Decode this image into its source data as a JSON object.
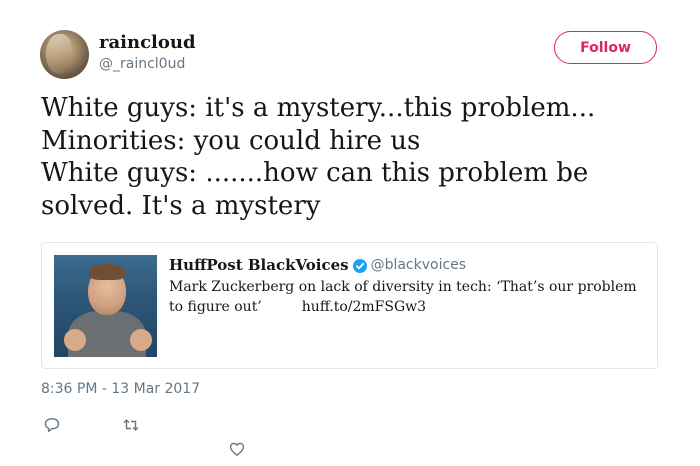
{
  "tweet": {
    "display_name": "raincloud",
    "username": "@_raincl0ud",
    "follow_label": "Follow",
    "text_lines": [
      "White guys: it's a mystery...this problem...",
      "Minorities: you could hire us",
      "White guys: .......how can this problem be",
      "solved. It's a mystery"
    ],
    "timestamp": "8:36 PM - 13 Mar 2017"
  },
  "quote": {
    "name": "HuffPost BlackVoices",
    "handle": "@blackvoices",
    "text_line1": "Mark Zuckerberg on lack of diversity in tech: ‘That’s our problem",
    "text_line2": "to figure out’",
    "link": "huff.to/2mFSGw3"
  },
  "icons": {
    "reply": "reply-icon",
    "retweet": "retweet-icon",
    "like": "heart-icon",
    "verified": "verified-badge-icon"
  },
  "colors": {
    "follow_accent": "#e0245e",
    "verified_blue": "#1da1f2",
    "secondary_text": "#657786"
  }
}
